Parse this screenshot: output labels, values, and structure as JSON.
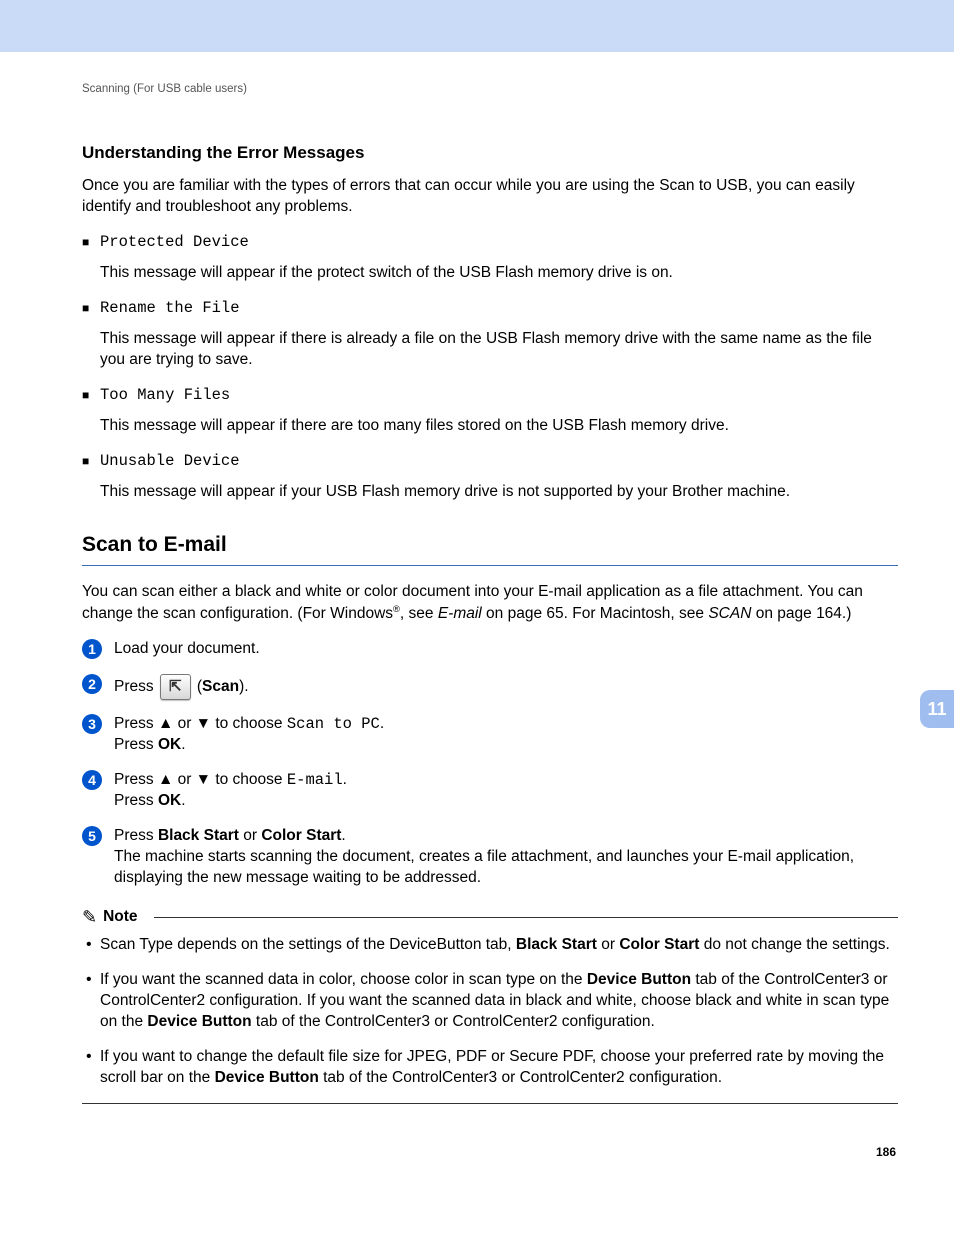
{
  "header": {
    "running_head": "Scanning (For USB cable users)"
  },
  "section1": {
    "title": "Understanding the Error Messages",
    "intro": "Once you are familiar with the types of errors that can occur while you are using the Scan to USB, you can easily identify and troubleshoot any problems.",
    "items": [
      {
        "label": "Protected Device",
        "desc": "This message will appear if the protect switch of the USB Flash memory drive is on."
      },
      {
        "label": "Rename the File",
        "desc": "This message will appear if there is already a file on the USB Flash memory drive with the same name as the file you are trying to save."
      },
      {
        "label": "Too Many Files",
        "desc": "This message will appear if there are too many files stored on the USB Flash memory drive."
      },
      {
        "label": "Unusable Device",
        "desc": "This message will appear if your USB Flash memory drive is not supported by your Brother machine."
      }
    ]
  },
  "section2": {
    "title": "Scan to E-mail",
    "para1": "You can scan either a black and white or color document into your E-mail application as a file attachment. You can change the scan configuration. (For Windows",
    "sup": "®",
    "para1b": ",  see ",
    "link1": "E-mail",
    "para1c": " on page 65. For Macintosh, see ",
    "link2": "SCAN",
    "para1d": " on page 164.)",
    "steps": {
      "s1": "Load your document.",
      "s2_pre": "Press ",
      "s2_label": "(",
      "s2_bold": "Scan",
      "s2_close": ").",
      "s3_pre": "Press ",
      "s3_arrows": "▲ or ▼",
      "s3_mid": " to choose ",
      "s3_code": "Scan to PC",
      "s3_dot": ".",
      "s3_line2_pre": "Press ",
      "s3_line2_bold": "OK",
      "s3_line2_dot": ".",
      "s4_pre": "Press ",
      "s4_arrows": "▲ or ▼",
      "s4_mid": " to choose ",
      "s4_code": "E-mail",
      "s4_dot": ".",
      "s4_line2_pre": "Press ",
      "s4_line2_bold": "OK",
      "s4_line2_dot": ".",
      "s5_pre": "Press ",
      "s5_bold1": "Black Start",
      "s5_or": " or ",
      "s5_bold2": "Color Start",
      "s5_dot": ".",
      "s5_line2": "The machine starts scanning the document, creates a file attachment, and launches your E-mail application, displaying the new message waiting to be addressed."
    },
    "note_title": "Note",
    "notes": {
      "n1_pre": "Scan Type depends on the settings of the DeviceButton tab, ",
      "n1_b1": "Black Start",
      "n1_or": " or ",
      "n1_b2": "Color Start",
      "n1_post": " do not change the settings.",
      "n2_pre": "If you want the scanned data in color, choose color in scan type on the ",
      "n2_b1": "Device Button",
      "n2_mid": " tab of the ControlCenter3 or ControlCenter2 configuration. If you want the scanned data in black and white, choose black and white in scan type on the ",
      "n2_b2": "Device Button",
      "n2_post": " tab of the ControlCenter3 or ControlCenter2 configuration.",
      "n3_pre": "If you want to change the default file size for JPEG, PDF or Secure PDF, choose your preferred rate by moving the scroll bar on the ",
      "n3_b1": "Device Button",
      "n3_post": " tab of the ControlCenter3 or ControlCenter2 configuration."
    }
  },
  "chapter_tab": "11",
  "page_number": "186",
  "icons": {
    "scan_glyph": "⇱",
    "note_glyph": "✎"
  }
}
